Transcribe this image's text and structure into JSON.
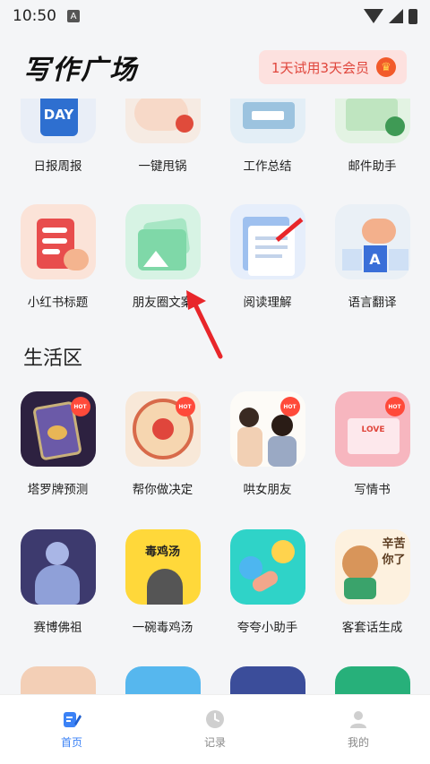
{
  "status": {
    "time": "10:50",
    "sim_label": "A"
  },
  "header": {
    "title": "写作广场",
    "trial_text": "1天试用3天会员"
  },
  "work_row1": [
    {
      "label": "日报周报",
      "icon": "calendar-day-icon",
      "icon_text": "DAY"
    },
    {
      "label": "一键甩锅",
      "icon": "pot-icon"
    },
    {
      "label": "工作总结",
      "icon": "summary-icon"
    },
    {
      "label": "邮件助手",
      "icon": "mail-icon"
    }
  ],
  "work_row2": [
    {
      "label": "小红书标题",
      "icon": "xiaohongshu-icon"
    },
    {
      "label": "朋友圈文案",
      "icon": "moments-photo-icon"
    },
    {
      "label": "阅读理解",
      "icon": "reading-icon"
    },
    {
      "label": "语言翻译",
      "icon": "translate-icon",
      "icon_text": "A"
    }
  ],
  "life_section_title": "生活区",
  "life_row1": [
    {
      "label": "塔罗牌预测",
      "icon": "tarot-icon",
      "badge": "HOT"
    },
    {
      "label": "帮你做决定",
      "icon": "decision-wheel-icon",
      "badge": "HOT"
    },
    {
      "label": "哄女朋友",
      "icon": "couple-icon",
      "badge": "HOT"
    },
    {
      "label": "写情书",
      "icon": "love-letter-icon",
      "badge": "HOT",
      "icon_text": "LOVE"
    }
  ],
  "life_row2": [
    {
      "label": "赛博佛祖",
      "icon": "buddha-icon"
    },
    {
      "label": "一碗毒鸡汤",
      "icon": "chicken-soup-icon",
      "icon_text": "毒鸡汤"
    },
    {
      "label": "夸夸小助手",
      "icon": "praise-icon"
    },
    {
      "label": "客套话生成",
      "icon": "raccoon-icon",
      "icon_text": "辛苦你了"
    }
  ],
  "nav": [
    {
      "label": "首页",
      "icon": "home-edit-icon",
      "active": true
    },
    {
      "label": "记录",
      "icon": "clock-icon",
      "active": false
    },
    {
      "label": "我的",
      "icon": "user-icon",
      "active": false
    }
  ],
  "colors": {
    "accent": "#3b82f6",
    "trial_bg": "#fde1df",
    "trial_text": "#e0463c",
    "arrow": "#e8262a"
  }
}
